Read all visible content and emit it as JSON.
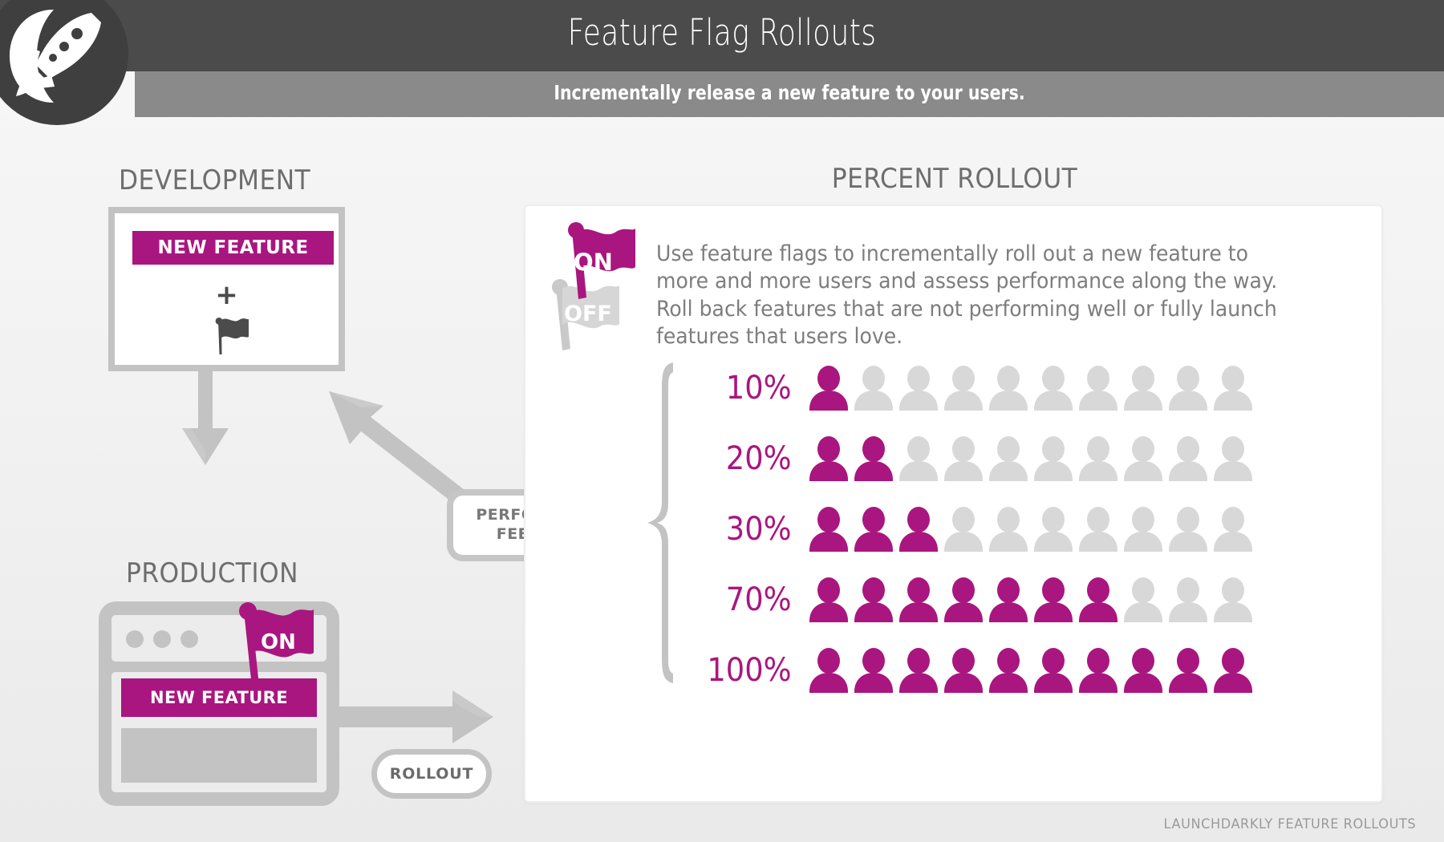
{
  "header": {
    "title": "Feature Flag Rollouts",
    "subtitle": "Incrementally release a new feature to your users.",
    "logo_icon": "rocket-icon",
    "bar_color": "#4b4b4b",
    "subbar_color": "#8a8a8a"
  },
  "theme": {
    "magenta": "#a9167f",
    "gray": "#c3c3c3",
    "light_gray": "#d8d8d8",
    "text_gray": "#6e6e6e",
    "dark": "#4b4b4b"
  },
  "development": {
    "section_label": "DEVELOPMENT",
    "feature_chip_label": "NEW FEATURE",
    "plus_symbol": "+",
    "flag_icon": "flag-icon"
  },
  "flow": {
    "down_arrow_icon": "arrow-down-icon",
    "feedback_arrow_icon": "arrow-up-left-icon",
    "feedback_label_line1": "PERFORMANCE",
    "feedback_label_line2": "FEEDBACK",
    "rollout_arrow_icon": "arrow-right-icon",
    "rollout_pill_label": "ROLLOUT"
  },
  "production": {
    "section_label": "PRODUCTION",
    "feature_chip_label": "NEW FEATURE",
    "flag_state_label": "ON",
    "flag_icon": "flag-on-icon",
    "window_dots": 3
  },
  "percent_rollout": {
    "section_label": "PERCENT ROLLOUT",
    "flag_on_label": "ON",
    "flag_off_label": "OFF",
    "flag_on_icon": "flag-on-icon",
    "flag_off_icon": "flag-off-icon",
    "brace_icon": "curly-brace-icon",
    "description": "Use feature flags to incrementally roll out a new feature to more and more users and assess performance along the way.  Roll back features that are not performing well or fully launch features that users love."
  },
  "chart_data": {
    "type": "bar",
    "title": "PERCENT ROLLOUT",
    "xlabel": "",
    "ylabel": "",
    "unit_icon": "person-icon",
    "icons_per_row": 10,
    "icon_value": 10,
    "categories": [
      "10%",
      "20%",
      "30%",
      "70%",
      "100%"
    ],
    "values": [
      10,
      20,
      30,
      70,
      100
    ],
    "filled_icons": [
      1,
      2,
      3,
      7,
      10
    ],
    "empty_icons": [
      9,
      8,
      7,
      3,
      0
    ],
    "filled_color": "#a9167f",
    "empty_color": "#d8d8d8",
    "legend": [],
    "grid": false
  },
  "footer": {
    "note": "LAUNCHDARKLY FEATURE ROLLOUTS"
  }
}
